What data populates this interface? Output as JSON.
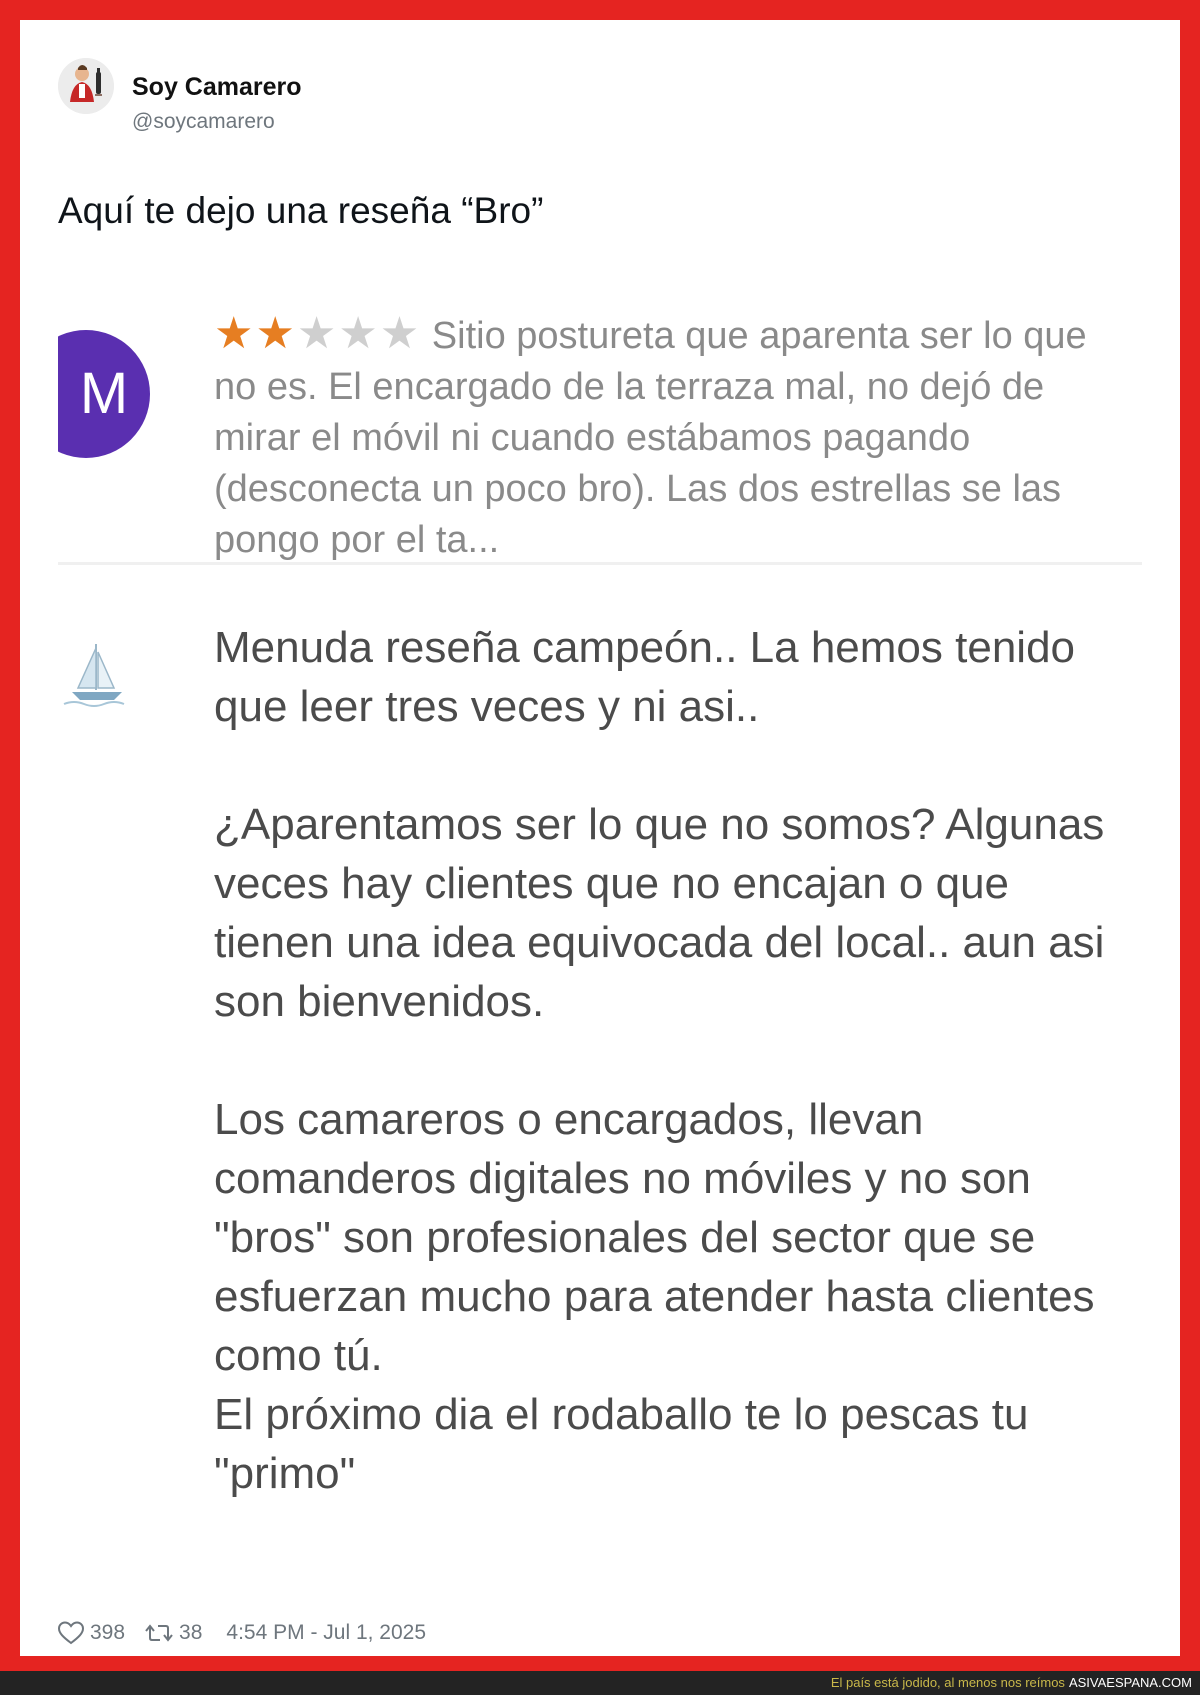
{
  "tweet": {
    "display_name": "Soy Camarero",
    "handle": "@soycamarero",
    "text": "Aquí te dejo una reseña “Bro”",
    "likes": "398",
    "retweets": "38",
    "timestamp": "4:54 PM - Jul 1, 2025"
  },
  "review": {
    "avatar_letter": "M",
    "avatar_color": "#5a2fb0",
    "rating": 2,
    "max_rating": 5,
    "star_on": "★★",
    "star_off": "★★★",
    "text": "Sitio postureta que aparenta ser lo que no es. El encargado de la terraza mal, no dejó de mirar el móvil ni cuando estábamos pagando (desconecta un poco bro). Las dos estrellas se las pongo por el ta..."
  },
  "reply": {
    "paragraphs": [
      "Menuda reseña campeón.. La hemos tenido que leer tres veces y ni asi..",
      "¿Aparentamos ser lo que no somos? Algunas veces hay clientes que no encajan o que tienen una idea equivocada del local.. aun asi son bienvenidos.",
      "Los camareros o encargados, llevan comanderos digitales no móviles y no son \"bros\" son profesionales del sector que se esfuerzan mucho para atender hasta clientes como tú.\nEl próximo dia el rodaballo te lo pescas tu \"primo\""
    ]
  },
  "footer": {
    "tagline": "El país está jodido, al menos nos reímos",
    "brand": "ASIVAESPANA.COM"
  },
  "colors": {
    "frame": "#e52421",
    "star_on": "#e67e22",
    "star_off": "#cfcfcf"
  }
}
